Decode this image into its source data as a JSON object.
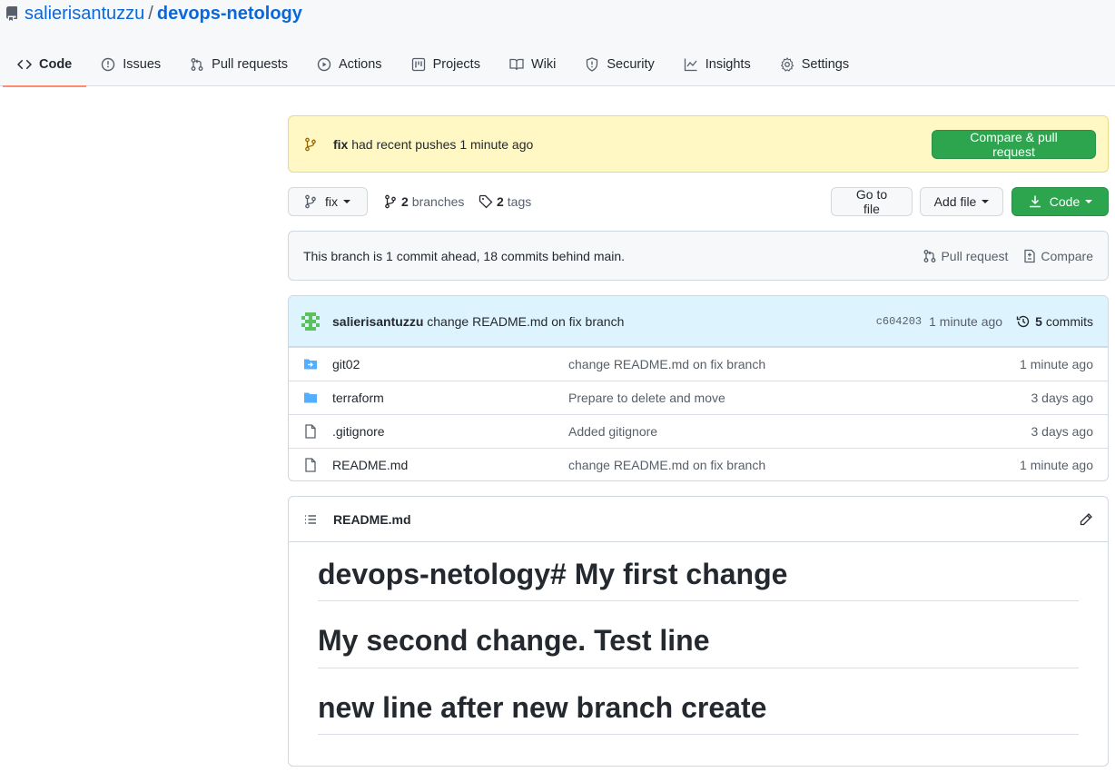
{
  "repo": {
    "owner": "salierisantuzzu",
    "separator": "/",
    "name": "devops-netology"
  },
  "tabs": [
    {
      "label": "Code",
      "icon": "code-icon"
    },
    {
      "label": "Issues",
      "icon": "issue-icon"
    },
    {
      "label": "Pull requests",
      "icon": "pull-request-icon"
    },
    {
      "label": "Actions",
      "icon": "play-icon"
    },
    {
      "label": "Projects",
      "icon": "project-icon"
    },
    {
      "label": "Wiki",
      "icon": "book-icon"
    },
    {
      "label": "Security",
      "icon": "shield-icon"
    },
    {
      "label": "Insights",
      "icon": "graph-icon"
    },
    {
      "label": "Settings",
      "icon": "gear-icon"
    }
  ],
  "push_banner": {
    "branch": "fix",
    "text": "had recent pushes 1 minute ago",
    "button": "Compare & pull request"
  },
  "branch_bar": {
    "current_branch": "fix",
    "branches_count": "2",
    "branches_label": "branches",
    "tags_count": "2",
    "tags_label": "tags",
    "goto_file": "Go to file",
    "add_file": "Add file",
    "code": "Code"
  },
  "ahead_behind": {
    "text": "This branch is 1 commit ahead, 18 commits behind main.",
    "pull_request": "Pull request",
    "compare": "Compare"
  },
  "latest_commit": {
    "author": "salierisantuzzu",
    "message": "change README.md on fix branch",
    "sha": "c604203",
    "age": "1 minute ago",
    "commits_count": "5",
    "commits_label": "commits"
  },
  "files": [
    {
      "name": "git02",
      "type": "submodule",
      "message": "change README.md on fix branch",
      "age": "1 minute ago"
    },
    {
      "name": "terraform",
      "type": "folder",
      "message": "Prepare to delete and move",
      "age": "3 days ago"
    },
    {
      "name": ".gitignore",
      "type": "file",
      "message": "Added gitignore",
      "age": "3 days ago"
    },
    {
      "name": "README.md",
      "type": "file",
      "message": "change README.md on fix branch",
      "age": "1 minute ago"
    }
  ],
  "readme": {
    "title": "README.md",
    "headings": [
      "devops-netology# My first change",
      "My second change. Test line",
      "new line after new branch create"
    ]
  },
  "colors": {
    "accent_link": "#0969da",
    "primary_button": "#2da44e",
    "banner_bg": "#fff8c5",
    "tab_underline": "#fd8c73"
  }
}
